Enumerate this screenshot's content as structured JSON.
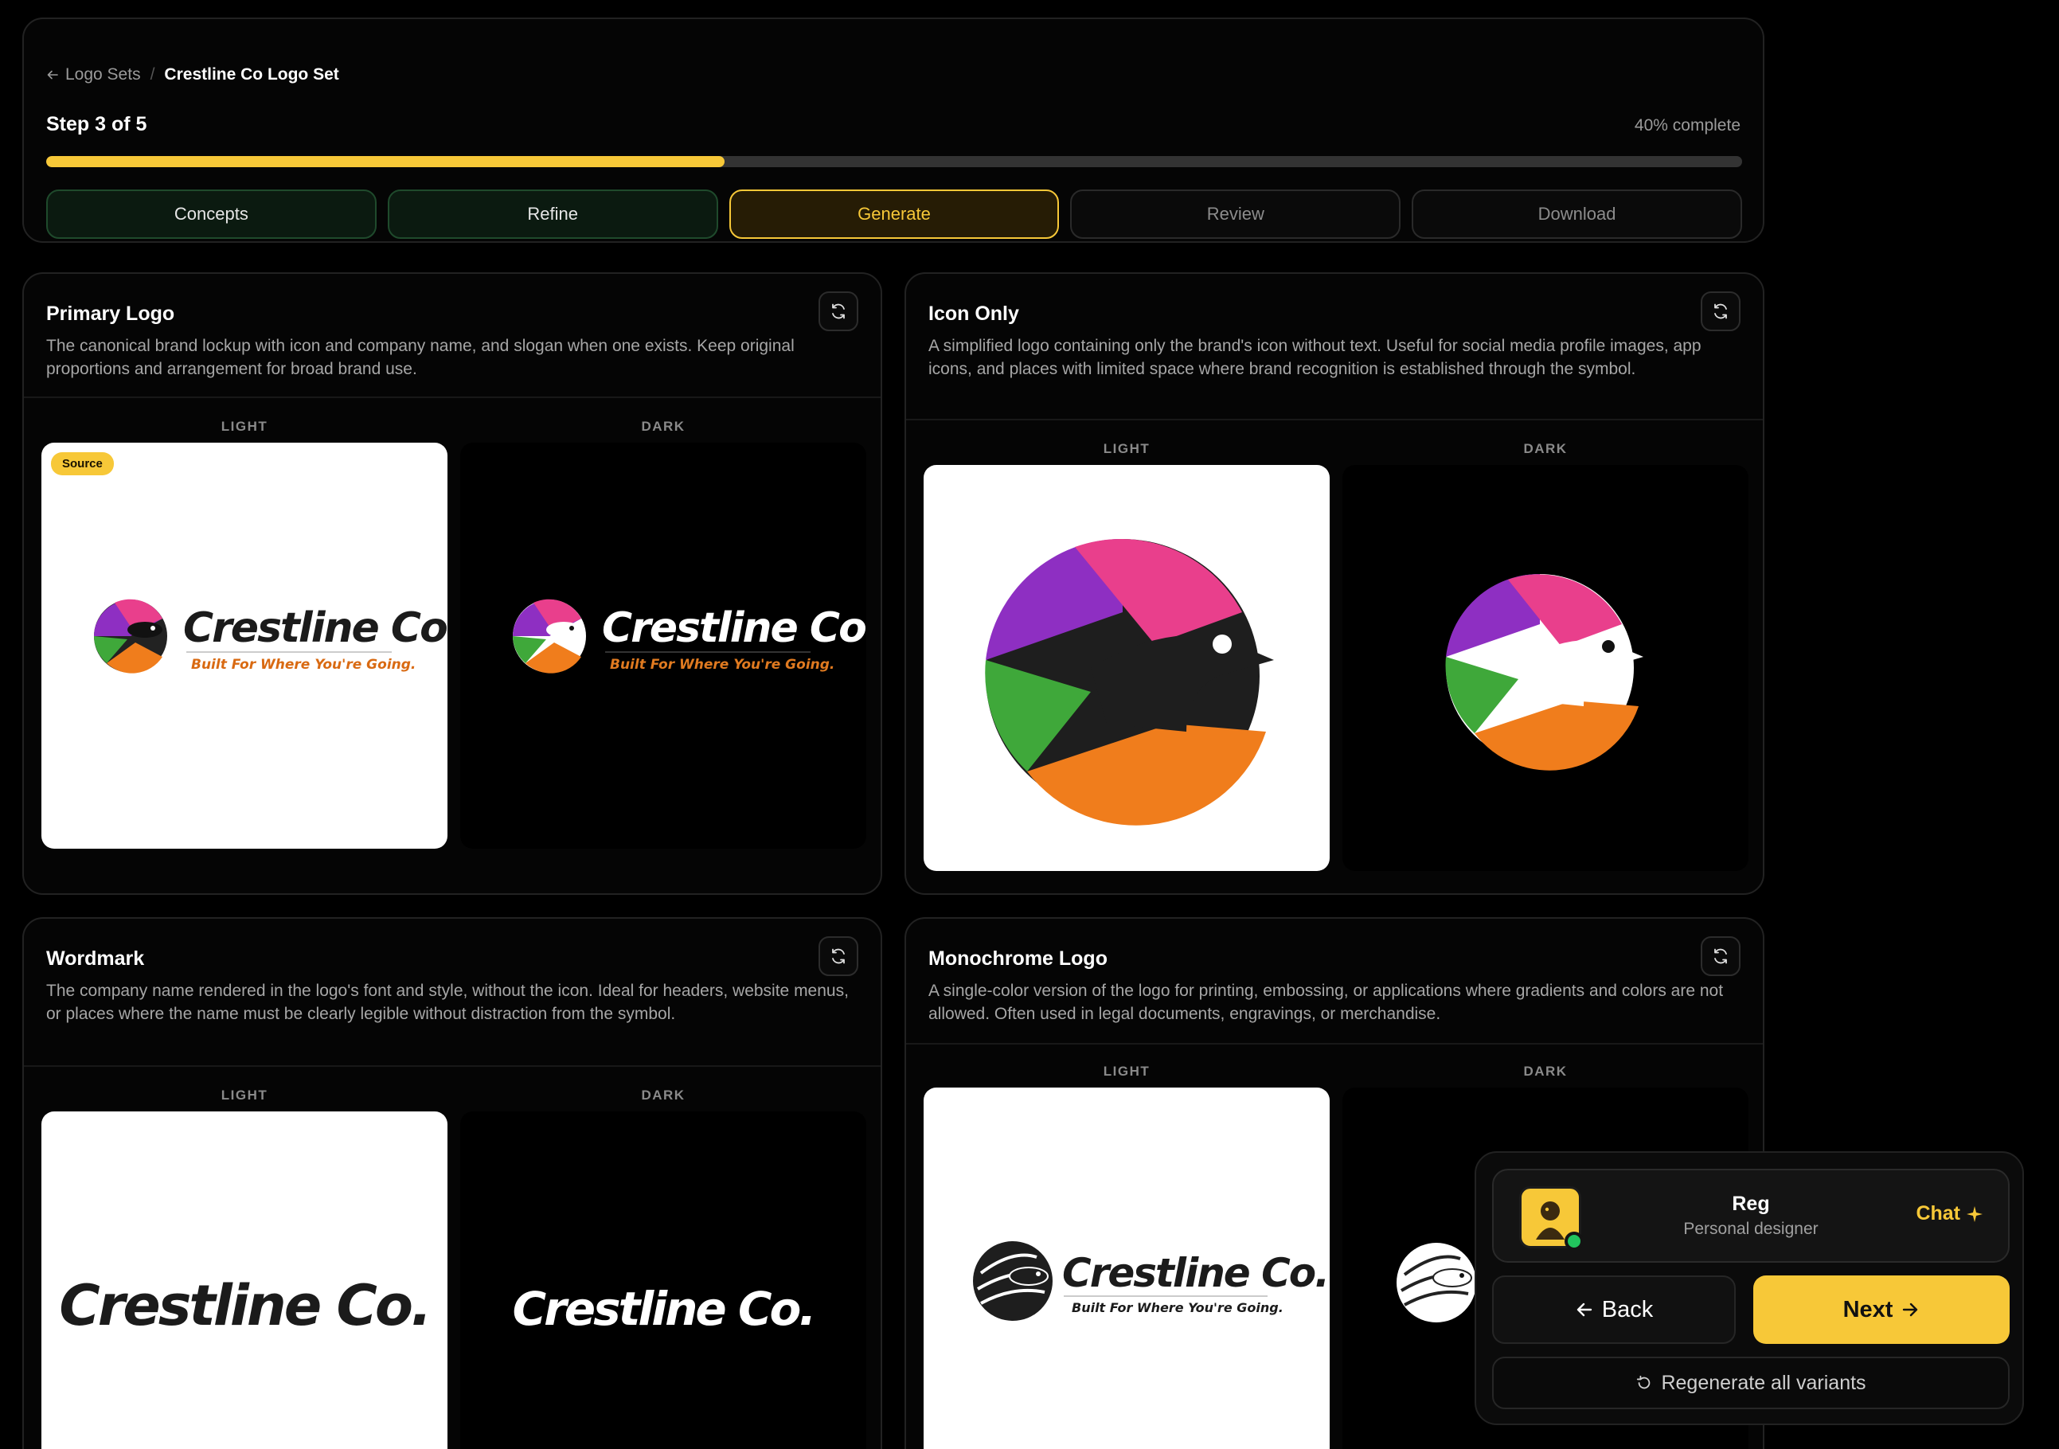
{
  "breadcrumb": {
    "back_label": "Logo Sets",
    "current": "Crestline Co Logo Set"
  },
  "progress": {
    "step_label": "Step 3 of 5",
    "percent_label": "40% complete",
    "fraction": 0.4
  },
  "steps": [
    {
      "label": "Concepts",
      "state": "done"
    },
    {
      "label": "Refine",
      "state": "done"
    },
    {
      "label": "Generate",
      "state": "active"
    },
    {
      "label": "Review",
      "state": "pending"
    },
    {
      "label": "Download",
      "state": "pending"
    }
  ],
  "columns": {
    "light": "LIGHT",
    "dark": "DARK"
  },
  "source_badge": "Source",
  "cards": {
    "primary": {
      "title": "Primary Logo",
      "description": "The canonical brand lockup with icon and company name, and slogan when one exists. Keep original proportions and arrangement for broad brand use."
    },
    "icon_only": {
      "title": "Icon Only",
      "description": "A simplified logo containing only the brand's icon without text. Useful for social media profile images, app icons, and places with limited space where brand recognition is established through the symbol."
    },
    "wordmark": {
      "title": "Wordmark",
      "description": "The company name rendered in the logo's font and style, without the icon. Ideal for headers, website menus, or places where the name must be clearly legible without distraction from the symbol."
    },
    "monochrome": {
      "title": "Monochrome Logo",
      "description": "A single-color version of the logo for printing, embossing, or applications where gradients and colors are not allowed. Often used in legal documents, engravings, or merchandise."
    }
  },
  "brand": {
    "name": "Crestline Co.",
    "slogan": "Built For Where You're Going."
  },
  "assistant": {
    "name": "Reg",
    "role": "Personal designer",
    "chat_label": "Chat",
    "back_label": "Back",
    "next_label": "Next",
    "regenerate_label": "Regenerate all variants"
  },
  "colors": {
    "accent": "#f7c838",
    "online": "#22c55e",
    "scale_purple": "#8e2fc2",
    "scale_pink": "#e93f8c",
    "scale_green": "#3fa83a",
    "scale_orange": "#f07d1c"
  }
}
